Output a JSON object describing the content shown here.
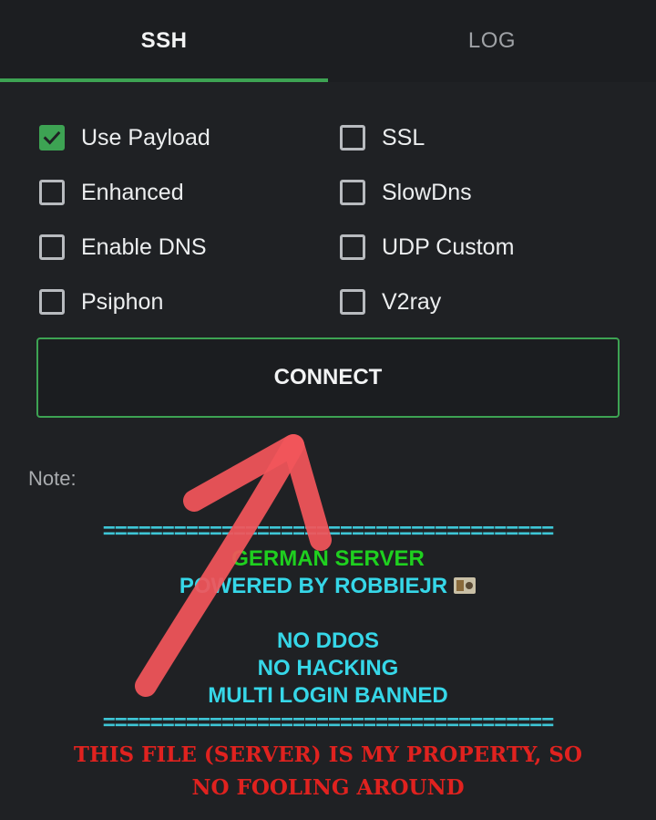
{
  "tabs": [
    {
      "label": "SSH",
      "active": true
    },
    {
      "label": "LOG",
      "active": false
    }
  ],
  "options": [
    {
      "label": "Use Payload",
      "checked": true
    },
    {
      "label": "SSL",
      "checked": false
    },
    {
      "label": "Enhanced",
      "checked": false
    },
    {
      "label": "SlowDns",
      "checked": false
    },
    {
      "label": "Enable DNS",
      "checked": false
    },
    {
      "label": "UDP Custom",
      "checked": false
    },
    {
      "label": "Psiphon",
      "checked": false
    },
    {
      "label": "V2ray",
      "checked": false
    }
  ],
  "connect_label": "CONNECT",
  "note": {
    "label": "Note:",
    "separator": "======================================",
    "server_name": "GERMAN SERVER",
    "powered_by": "POWERED BY ROBBIEJR",
    "rule_1": "NO DDOS",
    "rule_2": "NO HACKING",
    "rule_3": "MULTI LOGIN BANNED",
    "warning": "THIS FILE (SERVER) IS MY PROPERTY, SO NO FOOLING AROUND"
  },
  "colors": {
    "accent": "#3da353",
    "annotation_arrow": "#f2555a",
    "note_green": "#1fd01f",
    "note_cyan": "#36d7e8",
    "note_red": "#e0221f"
  },
  "icons": {
    "checkbox_checked": "check-icon",
    "badge": "money-icon",
    "annotation": "arrow-annotation-icon"
  }
}
